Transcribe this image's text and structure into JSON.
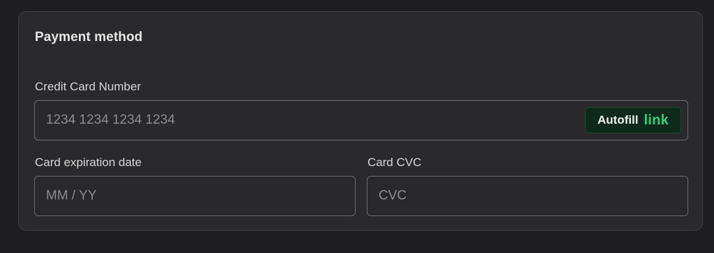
{
  "payment": {
    "title": "Payment method",
    "card_number": {
      "label": "Credit Card Number",
      "placeholder": "1234 1234 1234 1234",
      "value": ""
    },
    "autofill": {
      "label": "Autofill",
      "brand": "link",
      "brand_color": "#33d27a"
    },
    "expiration": {
      "label": "Card expiration date",
      "placeholder": "MM / YY",
      "value": ""
    },
    "cvc": {
      "label": "Card CVC",
      "placeholder": "CVC",
      "value": ""
    }
  }
}
